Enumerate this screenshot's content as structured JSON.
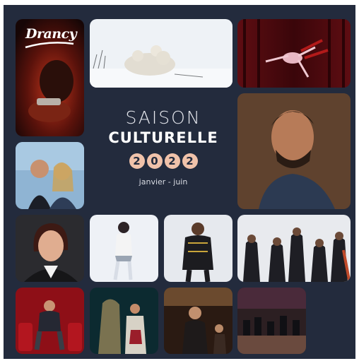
{
  "brand": {
    "logo_text": "Drancy"
  },
  "season": {
    "line1": "SAISON",
    "line2": "CULTURELLE",
    "year_digits": [
      "2",
      "0",
      "2",
      "2"
    ],
    "period": "janvier - juin"
  },
  "colors": {
    "background": "#232b3d",
    "accent": "#f0c2aa"
  }
}
